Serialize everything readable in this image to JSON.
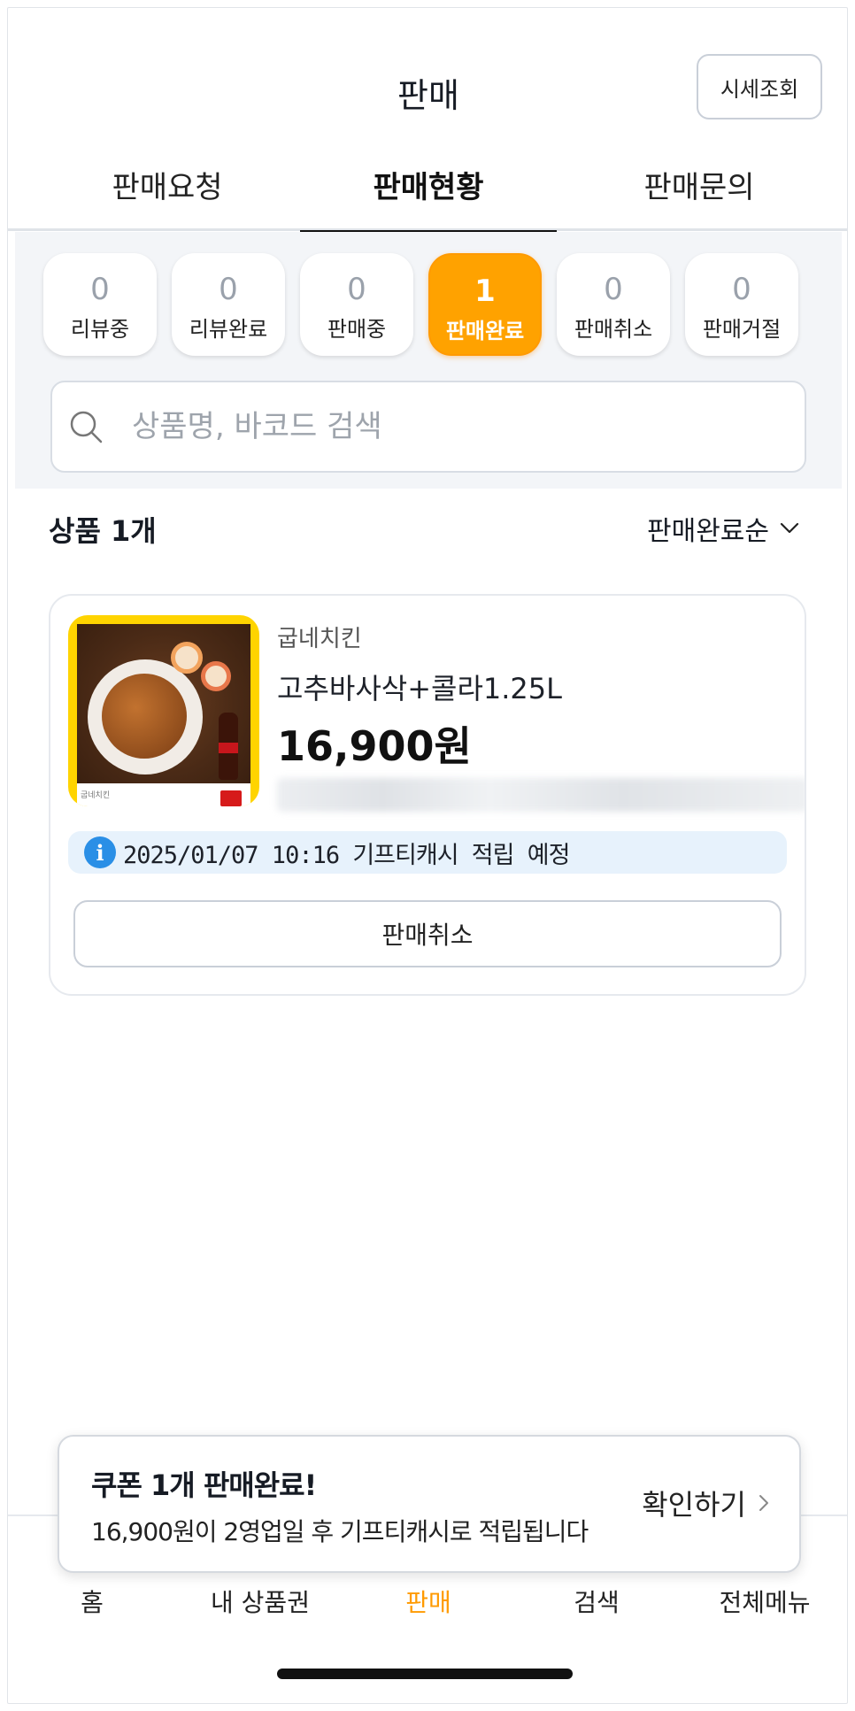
{
  "header": {
    "title": "판매",
    "price_check_label": "시세조회"
  },
  "tabs": [
    {
      "label": "판매요청",
      "active": false
    },
    {
      "label": "판매현황",
      "active": true
    },
    {
      "label": "판매문의",
      "active": false
    }
  ],
  "status_chips": [
    {
      "count": "0",
      "label": "리뷰중",
      "active": false
    },
    {
      "count": "0",
      "label": "리뷰완료",
      "active": false
    },
    {
      "count": "0",
      "label": "판매중",
      "active": false
    },
    {
      "count": "1",
      "label": "판매완료",
      "active": true
    },
    {
      "count": "0",
      "label": "판매취소",
      "active": false
    },
    {
      "count": "0",
      "label": "판매거절",
      "active": false
    }
  ],
  "search": {
    "placeholder": "상품명, 바코드 검색",
    "value": ""
  },
  "list": {
    "count_label": "상품 1개",
    "sort_label": "판매완료순"
  },
  "product": {
    "brand": "굽네치킨",
    "name": "고추바사삭+콜라1.25L",
    "price": "16,900원",
    "image_brand_text": "굽네치킨",
    "info_text": "2025/01/07 10:16 기프티캐시 적립 예정",
    "cancel_label": "판매취소"
  },
  "toast": {
    "title": "쿠폰 1개 판매완료!",
    "message": "16,900원이 2영업일 후 기프티캐시로 적립됩니다",
    "action_label": "확인하기"
  },
  "nav": [
    {
      "label": "홈",
      "active": false
    },
    {
      "label": "내 상품권",
      "active": false
    },
    {
      "label": "판매",
      "active": true
    },
    {
      "label": "검색",
      "active": false
    },
    {
      "label": "전체메뉴",
      "active": false
    }
  ],
  "colors": {
    "accent": "#ffa200",
    "info_bg": "#e7f2fc",
    "info_icon": "#2a8fe6"
  }
}
